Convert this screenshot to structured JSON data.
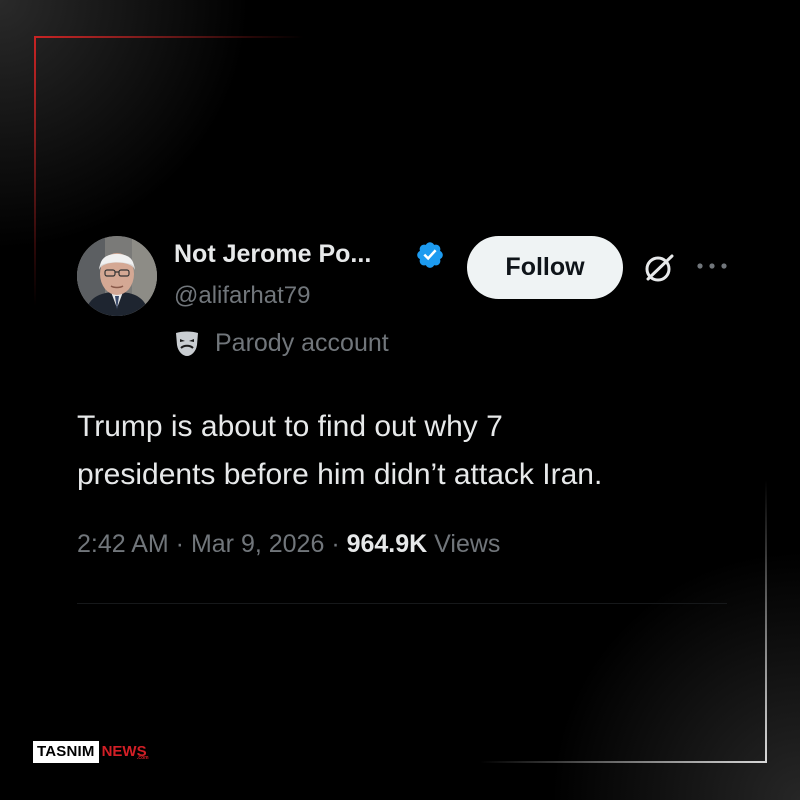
{
  "tweet": {
    "author": {
      "display_name": "Not Jerome Po...",
      "handle": "@alifarhat79",
      "verified": true,
      "label": "Parody account",
      "label_icon": "theater-mask-icon"
    },
    "follow_label": "Follow",
    "text_line1": "Trump is about to find out why 7",
    "text_line2": "presidents before him didn’t attack Iran.",
    "time": "2:42 AM",
    "sep1": " · ",
    "date": "Mar 9, 2026",
    "sep2": " · ",
    "views_count": "964.9K",
    "views_label": "Views"
  },
  "watermark": {
    "part1": "TASNIM",
    "part2": "NEWS",
    "suffix": ".com"
  },
  "colors": {
    "background": "#000000",
    "text_primary": "#e7e9ea",
    "text_secondary": "#71767b",
    "verified_blue": "#1d9bf0",
    "follow_bg": "#eff3f4",
    "frame_red": "#c82323",
    "brand_red": "#d21f26"
  }
}
